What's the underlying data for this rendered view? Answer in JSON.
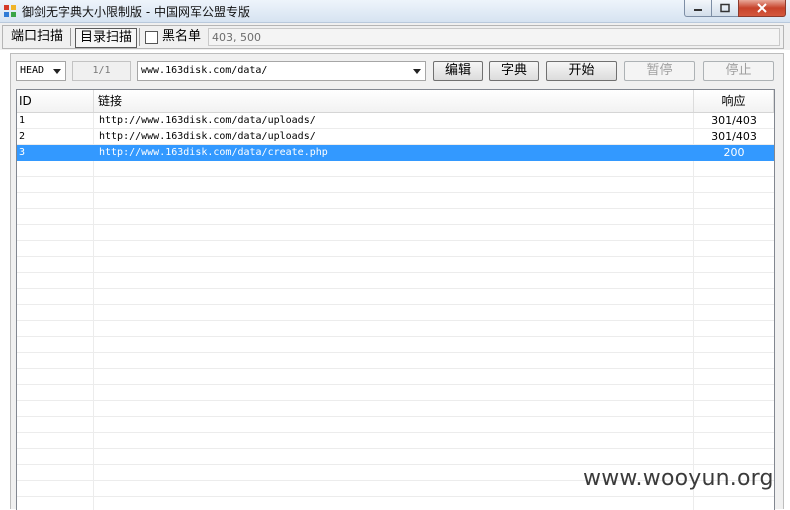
{
  "window": {
    "title": "御剑无字典大小限制版 - 中国网军公盟专版",
    "icon": "app-icon"
  },
  "tabs": [
    {
      "label": "端口扫描",
      "active": false
    },
    {
      "label": "目录扫描",
      "active": true
    }
  ],
  "blacklist": {
    "label": "黑名单",
    "checked": false,
    "codes_value": "403, 500"
  },
  "toolbar": {
    "method": "HEAD",
    "counter": "1/1",
    "url": "www.163disk.com/data/",
    "edit_label": "编辑",
    "dict_label": "字典",
    "start_label": "开始",
    "pause_label": "暂停",
    "stop_label": "停止"
  },
  "table": {
    "columns": [
      "ID",
      "链接",
      "响应"
    ],
    "rows": [
      {
        "id": "1",
        "link": "http://www.163disk.com/data/uploads/",
        "response": "301/403"
      },
      {
        "id": "2",
        "link": "http://www.163disk.com/data/uploads/",
        "response": "301/403"
      },
      {
        "id": "3",
        "link": "http://www.163disk.com/data/create.php",
        "response": "200"
      }
    ],
    "selected_row": 3
  },
  "watermark": "www.wooyun.org",
  "colors": {
    "selection": "#3399ff",
    "close_button": "#c7432b"
  }
}
